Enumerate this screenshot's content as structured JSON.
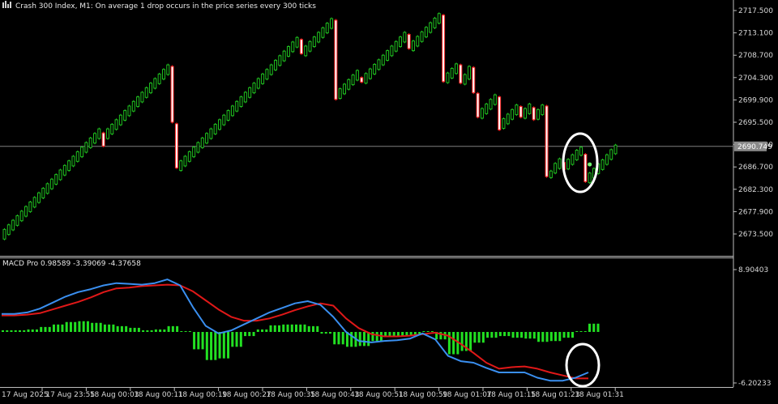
{
  "header": {
    "title": "Crash 300 Index, M1:  On average 1 drop occurs in the price series every 300 ticks",
    "title_icon": "chart-bars-icon"
  },
  "colors": {
    "background": "#000000",
    "bull_candle": "#1fbf1f",
    "bear_candle": "#ffffff",
    "bear_outline": "#ff2020",
    "macd_line": "#3a8ff0",
    "signal_line": "#e01818",
    "histogram": "#22e022",
    "price_line": "#808080",
    "annotation": "#ffffff"
  },
  "chart_data": [
    {
      "type": "candlestick",
      "name": "Crash 300 Index, M1",
      "ylim": [
        2671.0,
        2719.0
      ],
      "y_ticks": [
        "2717.500",
        "2713.100",
        "2708.700",
        "2704.300",
        "2699.900",
        "2695.500",
        "2691.100",
        "2686.700",
        "2682.300",
        "2677.900",
        "2673.500"
      ],
      "current_price": "2690.749",
      "bars": [
        [
          2672.5,
          2674.4
        ],
        [
          2673.4,
          2675.3
        ],
        [
          2674.3,
          2676.2
        ],
        [
          2675.2,
          2677.1
        ],
        [
          2676.1,
          2678.0
        ],
        [
          2677.0,
          2678.9
        ],
        [
          2677.9,
          2679.8
        ],
        [
          2678.8,
          2680.7
        ],
        [
          2679.7,
          2681.6
        ],
        [
          2680.6,
          2682.5
        ],
        [
          2681.5,
          2683.4
        ],
        [
          2682.4,
          2684.3
        ],
        [
          2683.3,
          2685.2
        ],
        [
          2684.2,
          2686.1
        ],
        [
          2685.1,
          2687.0
        ],
        [
          2686.0,
          2687.9
        ],
        [
          2686.9,
          2688.8
        ],
        [
          2687.8,
          2689.7
        ],
        [
          2688.7,
          2690.6
        ],
        [
          2689.6,
          2691.5
        ],
        [
          2690.5,
          2692.4
        ],
        [
          2691.4,
          2693.3
        ],
        [
          2692.3,
          2694.2
        ],
        [
          2693.4,
          2690.8
        ],
        [
          2692.3,
          2694.2
        ],
        [
          2693.2,
          2695.1
        ],
        [
          2694.1,
          2696.0
        ],
        [
          2695.0,
          2696.9
        ],
        [
          2695.9,
          2697.8
        ],
        [
          2696.8,
          2698.7
        ],
        [
          2697.7,
          2699.6
        ],
        [
          2698.6,
          2700.5
        ],
        [
          2699.5,
          2701.4
        ],
        [
          2700.4,
          2702.3
        ],
        [
          2701.3,
          2703.2
        ],
        [
          2702.2,
          2704.1
        ],
        [
          2703.1,
          2705.0
        ],
        [
          2704.0,
          2705.9
        ],
        [
          2704.9,
          2706.8
        ],
        [
          2706.5,
          2695.5
        ],
        [
          2695.2,
          2686.5
        ],
        [
          2686.0,
          2687.9
        ],
        [
          2686.9,
          2688.8
        ],
        [
          2687.8,
          2689.7
        ],
        [
          2688.7,
          2690.6
        ],
        [
          2689.6,
          2691.5
        ],
        [
          2690.5,
          2692.4
        ],
        [
          2691.4,
          2693.3
        ],
        [
          2692.3,
          2694.2
        ],
        [
          2693.2,
          2695.1
        ],
        [
          2694.1,
          2696.0
        ],
        [
          2695.0,
          2696.9
        ],
        [
          2695.9,
          2697.8
        ],
        [
          2696.8,
          2698.7
        ],
        [
          2697.7,
          2699.6
        ],
        [
          2698.6,
          2700.5
        ],
        [
          2699.5,
          2701.4
        ],
        [
          2700.4,
          2702.3
        ],
        [
          2701.3,
          2703.2
        ],
        [
          2702.2,
          2704.1
        ],
        [
          2703.1,
          2705.0
        ],
        [
          2704.0,
          2705.9
        ],
        [
          2704.9,
          2706.8
        ],
        [
          2705.8,
          2707.7
        ],
        [
          2706.7,
          2708.6
        ],
        [
          2707.6,
          2709.5
        ],
        [
          2708.5,
          2710.4
        ],
        [
          2709.4,
          2711.3
        ],
        [
          2710.3,
          2712.2
        ],
        [
          2711.8,
          2709.0
        ],
        [
          2708.6,
          2710.5
        ],
        [
          2709.5,
          2711.4
        ],
        [
          2710.4,
          2712.3
        ],
        [
          2711.3,
          2713.2
        ],
        [
          2712.2,
          2714.1
        ],
        [
          2713.1,
          2715.0
        ],
        [
          2714.0,
          2715.9
        ],
        [
          2715.6,
          2700.0
        ],
        [
          2700.2,
          2702.1
        ],
        [
          2701.1,
          2703.0
        ],
        [
          2702.0,
          2703.9
        ],
        [
          2702.9,
          2704.8
        ],
        [
          2703.8,
          2705.7
        ],
        [
          2704.3,
          2703.4
        ],
        [
          2703.2,
          2705.1
        ],
        [
          2704.1,
          2706.0
        ],
        [
          2705.0,
          2706.9
        ],
        [
          2705.9,
          2707.8
        ],
        [
          2706.8,
          2708.7
        ],
        [
          2707.7,
          2709.6
        ],
        [
          2708.6,
          2710.5
        ],
        [
          2709.5,
          2711.4
        ],
        [
          2710.4,
          2712.3
        ],
        [
          2711.3,
          2713.2
        ],
        [
          2712.8,
          2710.0
        ],
        [
          2709.6,
          2711.5
        ],
        [
          2710.5,
          2712.4
        ],
        [
          2711.4,
          2713.3
        ],
        [
          2712.3,
          2714.2
        ],
        [
          2713.2,
          2715.1
        ],
        [
          2714.1,
          2716.0
        ],
        [
          2715.0,
          2716.9
        ],
        [
          2716.6,
          2703.5
        ],
        [
          2703.3,
          2705.2
        ],
        [
          2704.2,
          2706.1
        ],
        [
          2705.1,
          2707.0
        ],
        [
          2706.8,
          2703.2
        ],
        [
          2703.0,
          2704.9
        ],
        [
          2704.0,
          2706.5
        ],
        [
          2706.3,
          2701.3
        ],
        [
          2701.2,
          2696.5
        ],
        [
          2696.3,
          2698.2
        ],
        [
          2697.2,
          2699.1
        ],
        [
          2698.1,
          2700.0
        ],
        [
          2699.0,
          2700.9
        ],
        [
          2700.5,
          2694.0
        ],
        [
          2694.3,
          2696.2
        ],
        [
          2695.2,
          2697.1
        ],
        [
          2696.1,
          2698.0
        ],
        [
          2697.0,
          2698.9
        ],
        [
          2698.6,
          2696.5
        ],
        [
          2696.3,
          2698.2
        ],
        [
          2697.2,
          2699.1
        ],
        [
          2698.4,
          2696.0
        ],
        [
          2696.1,
          2698.0
        ],
        [
          2697.0,
          2698.9
        ],
        [
          2698.7,
          2684.8
        ],
        [
          2684.6,
          2685.9
        ],
        [
          2685.5,
          2687.4
        ],
        [
          2686.4,
          2688.3
        ],
        [
          2687.6,
          2686.2
        ],
        [
          2686.3,
          2688.2
        ],
        [
          2687.2,
          2689.1
        ],
        [
          2688.1,
          2690.0
        ],
        [
          2689.0,
          2690.6
        ],
        [
          2689.2,
          2683.8
        ],
        [
          2683.6,
          2685.5
        ],
        [
          2684.5,
          2686.4
        ],
        [
          2685.4,
          2687.3
        ],
        [
          2686.2,
          2688.1
        ],
        [
          2687.2,
          2689.1
        ],
        [
          2688.2,
          2690.1
        ],
        [
          2689.3,
          2691.0
        ]
      ]
    },
    {
      "type": "line",
      "name": "MACD Pro",
      "values_label": "MACD Pro 0.98589 -3.39069 -4.37658",
      "ylim": [
        -6.20233,
        8.90403
      ],
      "y_ticks": [
        "8.90403",
        "-6.20233"
      ],
      "series": [
        {
          "name": "MACD",
          "values": [
            3.0,
            3.0,
            3.2,
            3.7,
            4.5,
            5.3,
            5.9,
            6.3,
            6.8,
            7.1,
            7.0,
            6.9,
            7.1,
            7.6,
            6.8,
            3.9,
            1.4,
            0.4,
            0.8,
            1.6,
            2.4,
            3.2,
            3.8,
            4.4,
            4.7,
            4.2,
            2.6,
            0.6,
            -0.6,
            -0.8,
            -0.6,
            -0.5,
            -0.3,
            0.4,
            -0.4,
            -2.6,
            -3.3,
            -3.5,
            -4.2,
            -4.8,
            -4.8,
            -4.8,
            -5.5,
            -5.9,
            -5.9,
            -5.5,
            -4.8
          ]
        },
        {
          "name": "Signal",
          "values": [
            2.8,
            2.8,
            2.9,
            3.1,
            3.6,
            4.1,
            4.6,
            5.2,
            5.9,
            6.4,
            6.5,
            6.7,
            6.8,
            6.9,
            6.8,
            6.0,
            4.8,
            3.6,
            2.6,
            2.1,
            2.1,
            2.4,
            2.9,
            3.5,
            4.0,
            4.4,
            4.1,
            2.4,
            1.1,
            0.3,
            -0.0,
            -0.0,
            0.1,
            0.3,
            0.5,
            0.1,
            -1.0,
            -2.2,
            -3.5,
            -4.3,
            -4.1,
            -4.0,
            -4.3,
            -4.8,
            -5.2,
            -5.6,
            -5.6
          ]
        },
        {
          "name": "Histogram",
          "values": [
            0.2,
            0.2,
            0.3,
            0.6,
            0.9,
            1.2,
            1.3,
            1.1,
            0.9,
            0.7,
            0.5,
            0.2,
            0.3,
            0.7,
            0.0,
            -2.1,
            -3.4,
            -3.2,
            -1.8,
            -0.5,
            0.3,
            0.8,
            0.9,
            0.9,
            0.7,
            -0.2,
            -1.5,
            -1.8,
            -1.7,
            -1.1,
            -0.6,
            -0.5,
            -0.4,
            0.1,
            -0.9,
            -2.7,
            -2.3,
            -1.3,
            -0.7,
            -0.5,
            -0.7,
            -0.8,
            -1.2,
            -1.1,
            -0.7,
            0.1,
            1.0
          ]
        }
      ]
    }
  ],
  "time_axis": [
    "17 Aug 2025",
    "17 Aug 23:55",
    "18 Aug 00:03",
    "18 Aug 00:11",
    "18 Aug 00:19",
    "18 Aug 00:27",
    "18 Aug 00:35",
    "18 Aug 00:43",
    "18 Aug 00:51",
    "18 Aug 00:59",
    "18 Aug 01:07",
    "18 Aug 01:15",
    "18 Aug 01:23",
    "18 Aug 01:31"
  ],
  "annotations": [
    "circle-highlight-price",
    "circle-highlight-macd"
  ]
}
